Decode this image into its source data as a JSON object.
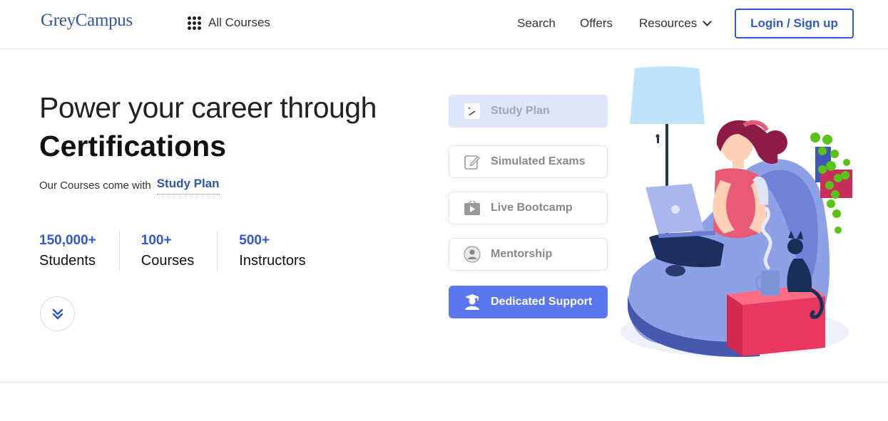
{
  "nav": {
    "logo": "GreyCampus",
    "all_courses": "All Courses",
    "search": "Search",
    "offers": "Offers",
    "resources": "Resources",
    "login": "Login / Sign up"
  },
  "hero": {
    "headline_line1": "Power your career through",
    "headline_line2": "Certifications",
    "subline_prefix": "Our Courses come with",
    "subline_highlight": "Study Plan"
  },
  "stats": [
    {
      "value": "150,000+",
      "label": "Students"
    },
    {
      "value": "100+",
      "label": "Courses"
    },
    {
      "value": "500+",
      "label": "Instructors"
    }
  ],
  "features": [
    {
      "label": "Study Plan",
      "icon": "study-plan-icon",
      "state": "selected"
    },
    {
      "label": "Simulated Exams",
      "icon": "edit-icon",
      "state": "default"
    },
    {
      "label": "Live Bootcamp",
      "icon": "video-icon",
      "state": "default"
    },
    {
      "label": "Mentorship",
      "icon": "user-icon",
      "state": "default"
    },
    {
      "label": "Dedicated Support",
      "icon": "graduate-icon",
      "state": "active"
    }
  ],
  "colors": {
    "brand": "#3057a5",
    "accent": "#3057d5",
    "active_feature": "#5a77f0",
    "selected_feature": "#dfe6fb"
  }
}
